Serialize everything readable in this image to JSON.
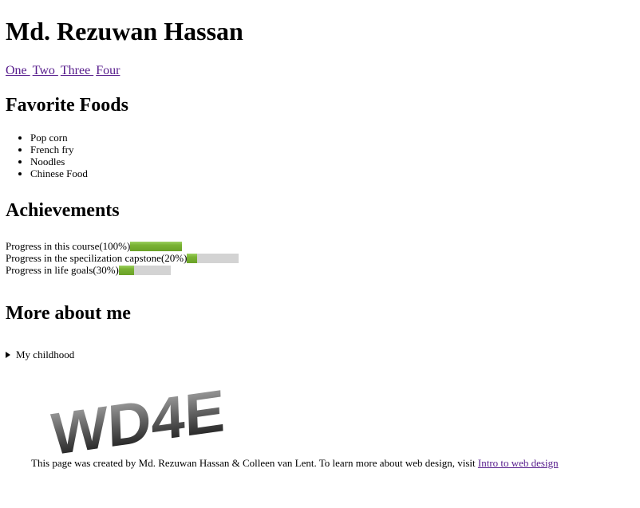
{
  "header": {
    "title": "Md. Rezuwan Hassan"
  },
  "nav": {
    "links": [
      {
        "label": "One "
      },
      {
        "label": "Two "
      },
      {
        "label": "Three "
      },
      {
        "label": "Four "
      }
    ]
  },
  "foods": {
    "heading": "Favorite Foods",
    "items": [
      "Pop corn",
      "French fry",
      "Noodles",
      "Chinese Food"
    ]
  },
  "achievements": {
    "heading": "Achievements",
    "items": [
      {
        "label": "Progress in this course(100%)",
        "value": 1.0
      },
      {
        "label": "Progress in the specilization capstone(20%)",
        "value": 0.2
      },
      {
        "label": "Progress in life goals(30%)",
        "value": 0.3
      }
    ]
  },
  "more": {
    "heading": "More about me",
    "summary": "My childhood"
  },
  "logo": {
    "text": "WD4E"
  },
  "footer": {
    "text": "This page was created by Md. Rezuwan Hassan & Colleen van Lent. To learn more about web design, visit ",
    "link_label": "Intro to web design"
  },
  "colors": {
    "link": "#551a8b",
    "progress": "#7ab334",
    "track": "#d3d3d3"
  }
}
